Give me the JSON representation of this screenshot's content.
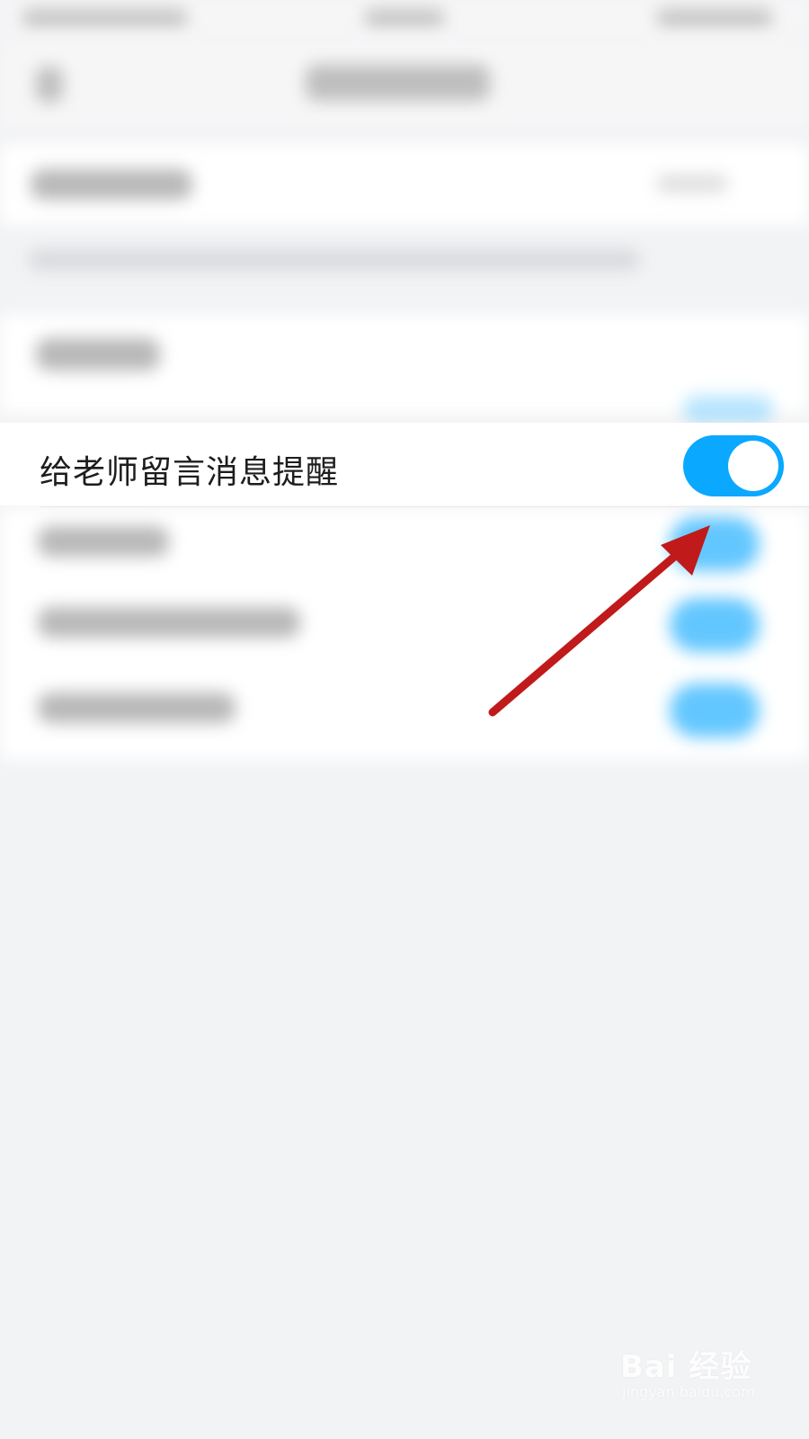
{
  "settings": {
    "teacher_message_reminder": {
      "label": "给老师留言消息提醒",
      "enabled": true
    }
  },
  "annotation": {
    "arrow_color": "#c01a1a"
  },
  "watermark": {
    "logo_text": "Bai 经验",
    "url_text": "jingyan.baidu.com"
  },
  "colors": {
    "toggle_on": "#0aa8ff",
    "background": "#f2f3f5"
  }
}
